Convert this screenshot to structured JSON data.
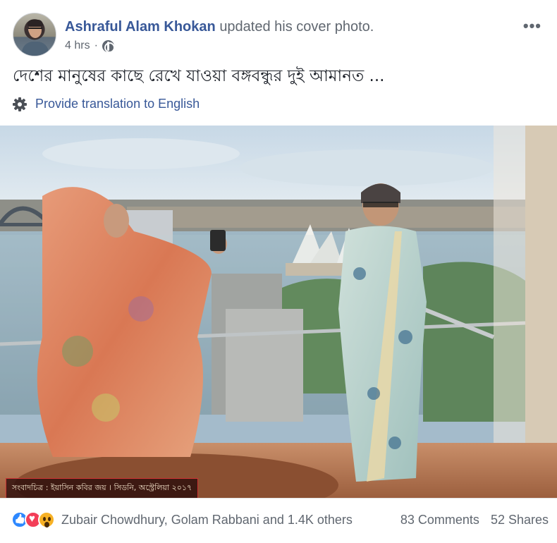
{
  "post": {
    "author": "Ashraful Alam Khokan",
    "action": "updated his cover photo.",
    "time": "4 hrs",
    "separator": "·",
    "audience_icon": "globe-icon",
    "more_icon": "more-options-icon",
    "more_label": "•••",
    "caption": "দেশের মানুষের কাছে রেখে যাওয়া বঙ্গবন্ধুর দুই আমানত ...",
    "translate_label": "Provide translation to English",
    "photo_credit": "সংবাদচিত্র : ইয়াসিন কবির জয় । সিডনি, অস্ট্রেলিয়া ২০১৭"
  },
  "footer": {
    "reactions": [
      "like-icon",
      "love-icon",
      "wow-icon"
    ],
    "reaction_names": "Zubair Chowdhury, Golam Rabbani and 1.4K others",
    "comments": "83 Comments",
    "shares": "52 Shares"
  },
  "colors": {
    "link": "#385898",
    "secondary_text": "#606770",
    "like": "#2d88ff",
    "love": "#f33e58",
    "wow": "#f7b125"
  }
}
